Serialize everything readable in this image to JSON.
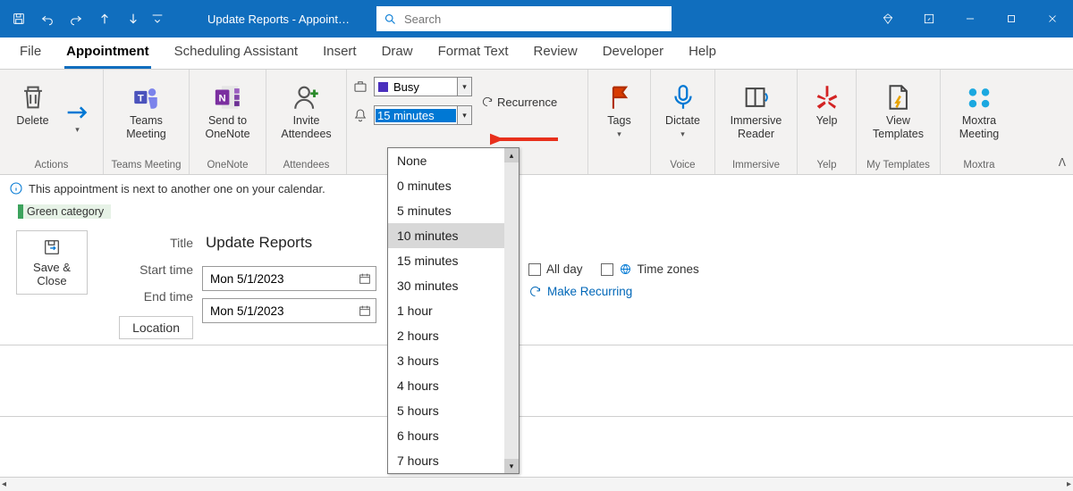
{
  "titlebar": {
    "title": "Update Reports  -  Appoint…",
    "search_placeholder": "Search"
  },
  "tabs": [
    "File",
    "Appointment",
    "Scheduling Assistant",
    "Insert",
    "Draw",
    "Format Text",
    "Review",
    "Developer",
    "Help"
  ],
  "active_tab": 1,
  "ribbon": {
    "delete": "Delete",
    "actions_caption": "Actions",
    "teams": "Teams\nMeeting",
    "teams_caption": "Teams Meeting",
    "onenote": "Send to\nOneNote",
    "onenote_caption": "OneNote",
    "invite": "Invite\nAttendees",
    "invite_caption": "Attendees",
    "busy": "Busy",
    "reminder": "15 minutes",
    "recurrence": "Recurrence",
    "tags": "Tags",
    "dictate": "Dictate",
    "voice_caption": "Voice",
    "immersive": "Immersive\nReader",
    "immersive_caption": "Immersive",
    "yelp": "Yelp",
    "yelp_caption": "Yelp",
    "templates": "View\nTemplates",
    "templates_caption": "My Templates",
    "moxtra": "Moxtra\nMeeting",
    "moxtra_caption": "Moxtra"
  },
  "info": "This appointment is next to another one on your calendar.",
  "category": "Green category",
  "form": {
    "saveclose": "Save &\nClose",
    "title_label": "Title",
    "title_value": "Update Reports",
    "start_label": "Start time",
    "end_label": "End time",
    "start_value": "Mon 5/1/2023",
    "end_value": "Mon 5/1/2023",
    "location_label": "Location",
    "allday": "All day",
    "timezones": "Time zones",
    "make_recurring": "Make Recurring"
  },
  "reminder_options": [
    "None",
    "0 minutes",
    "5 minutes",
    "10 minutes",
    "15 minutes",
    "30 minutes",
    "1 hour",
    "2 hours",
    "3 hours",
    "4 hours",
    "5 hours",
    "6 hours",
    "7 hours"
  ],
  "reminder_hover_index": 3
}
